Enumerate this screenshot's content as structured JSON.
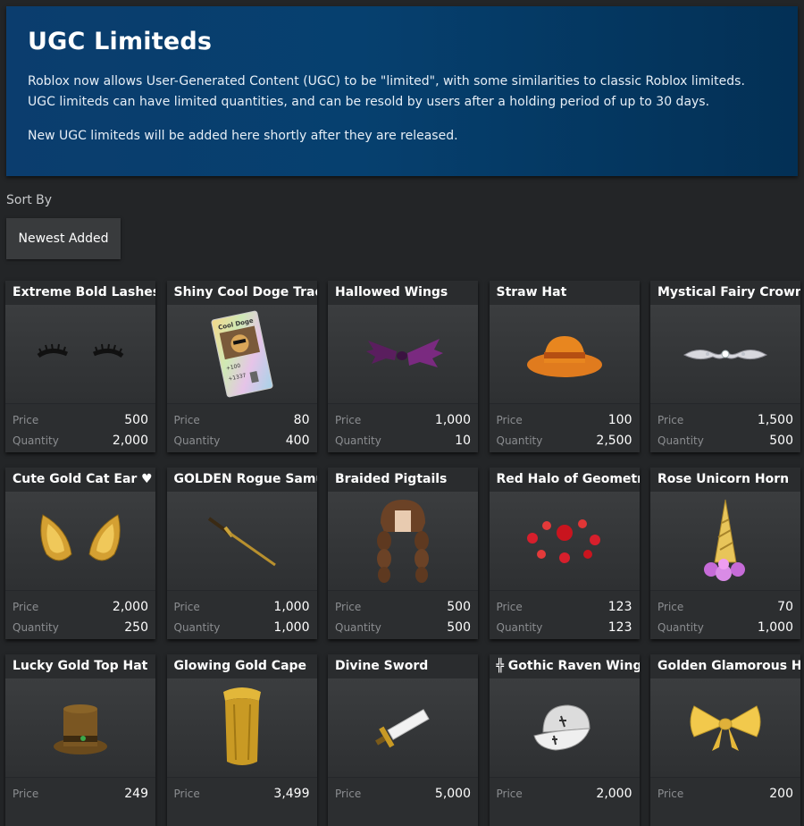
{
  "banner": {
    "title": "UGC Limiteds",
    "paragraph1": "Roblox now allows User-Generated Content (UGC) to be \"limited\", with some similarities to classic Roblox limiteds. UGC limiteds can have limited quantities, and can be resold by users after a holding period of up to 30 days.",
    "paragraph2": "New UGC limiteds will be added here shortly after they are released."
  },
  "sort": {
    "label": "Sort By",
    "selected": "Newest Added"
  },
  "labels": {
    "price": "Price",
    "quantity": "Quantity"
  },
  "items": [
    {
      "name": "Extreme Bold Lashes",
      "price": "500",
      "quantity": "2,000",
      "icon": "lashes-icon"
    },
    {
      "name": "Shiny Cool Doge Trading Card",
      "price": "80",
      "quantity": "400",
      "icon": "trading-card-icon",
      "card_text": "Cool Doge",
      "card_stats": [
        "+100",
        "+1337"
      ]
    },
    {
      "name": "Hallowed Wings",
      "price": "1,000",
      "quantity": "10",
      "icon": "wings-icon"
    },
    {
      "name": "Straw Hat",
      "price": "100",
      "quantity": "2,500",
      "icon": "straw-hat-icon"
    },
    {
      "name": "Mystical Fairy Crown",
      "price": "1,500",
      "quantity": "500",
      "icon": "crown-icon"
    },
    {
      "name": "Cute Gold Cat Ear ♥",
      "price": "2,000",
      "quantity": "250",
      "icon": "cat-ears-icon"
    },
    {
      "name": "GOLDEN Rogue Samurai",
      "price": "1,000",
      "quantity": "1,000",
      "icon": "katana-icon"
    },
    {
      "name": "Braided Pigtails",
      "price": "500",
      "quantity": "500",
      "icon": "pigtails-icon"
    },
    {
      "name": "Red Halo of Geometric",
      "price": "123",
      "quantity": "123",
      "icon": "red-halo-icon"
    },
    {
      "name": "Rose Unicorn Horn",
      "price": "70",
      "quantity": "1,000",
      "icon": "unicorn-horn-icon"
    },
    {
      "name": "Lucky Gold Top Hat",
      "price": "249",
      "icon": "top-hat-icon"
    },
    {
      "name": "Glowing Gold Cape",
      "price": "3,499",
      "icon": "gold-cape-icon"
    },
    {
      "name": "Divine Sword",
      "price": "5,000",
      "icon": "sword-icon"
    },
    {
      "name": "╬ Gothic Raven Wing G",
      "price": "2,000",
      "icon": "gothic-cap-icon"
    },
    {
      "name": "Golden Glamorous Head Bow",
      "price": "200",
      "icon": "head-bow-icon"
    }
  ]
}
